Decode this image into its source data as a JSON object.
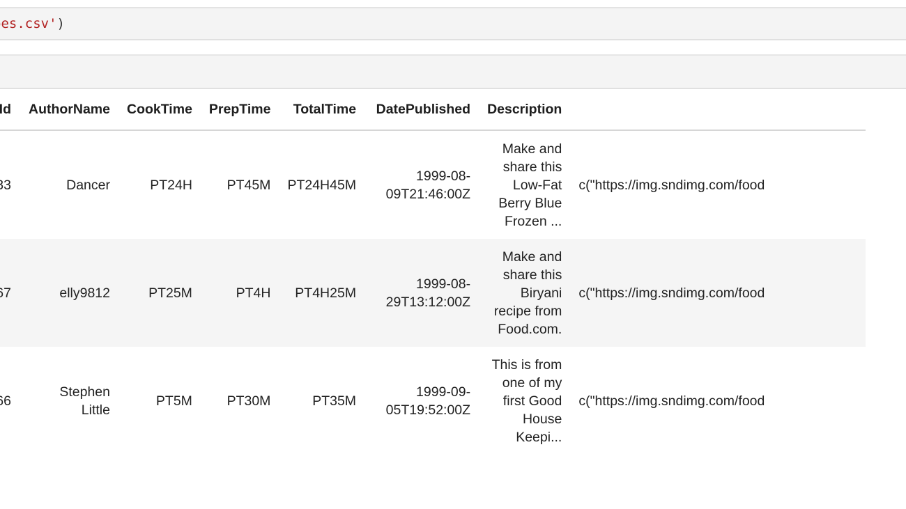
{
  "code_cell": {
    "visible_code_string": "pes.csv'",
    "visible_code_close": ")"
  },
  "dataframe": {
    "columns": [
      "rId",
      "AuthorName",
      "CookTime",
      "PrepTime",
      "TotalTime",
      "DatePublished",
      "Description",
      ""
    ],
    "rows": [
      {
        "id": "33",
        "author": "Dancer",
        "cook": "PT24H",
        "prep": "PT45M",
        "total": "PT24H45M",
        "date": "1999-08-09T21:46:00Z",
        "description": "Make and share this Low-Fat Berry Blue Frozen ...",
        "images": "c(\"https://img.sndimg.com/food"
      },
      {
        "id": "67",
        "author": "elly9812",
        "cook": "PT25M",
        "prep": "PT4H",
        "total": "PT4H25M",
        "date": "1999-08-29T13:12:00Z",
        "description": "Make and share this Biryani recipe from Food.com.",
        "images": "c(\"https://img.sndimg.com/food"
      },
      {
        "id": "66",
        "author": "Stephen Little",
        "cook": "PT5M",
        "prep": "PT30M",
        "total": "PT35M",
        "date": "1999-09-05T19:52:00Z",
        "description": "This is from one of my first Good House Keepi...",
        "images": "c(\"https://img.sndimg.com/food"
      }
    ]
  }
}
